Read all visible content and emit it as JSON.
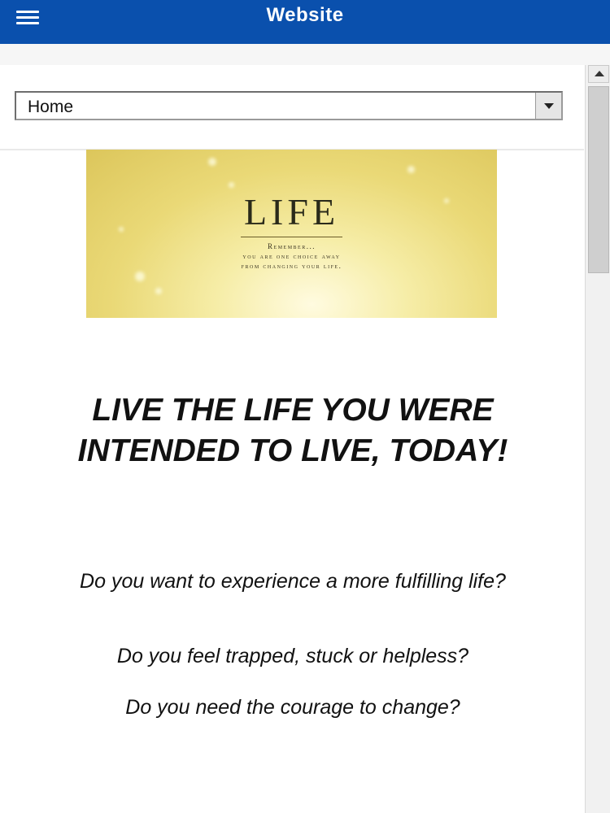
{
  "appbar": {
    "title": "Website",
    "menu_icon": "hamburger-menu-icon",
    "background": "#0a50ad"
  },
  "nav": {
    "selected": "Home",
    "dropdown_icon": "chevron-down-icon"
  },
  "banner": {
    "title": "LIFE",
    "sub_line1": "Remember...",
    "sub_line2": "you are one choice away",
    "sub_line3": "from changing your life."
  },
  "content": {
    "headline": "LIVE THE LIFE YOU WERE INTENDED TO LIVE, TODAY!",
    "questions": [
      "Do you want to experience a more fulfilling life?",
      "Do you feel trapped, stuck or helpless?",
      "Do you need the courage to change?"
    ]
  },
  "scrollbar": {
    "up_icon": "scroll-up-arrow-icon"
  }
}
